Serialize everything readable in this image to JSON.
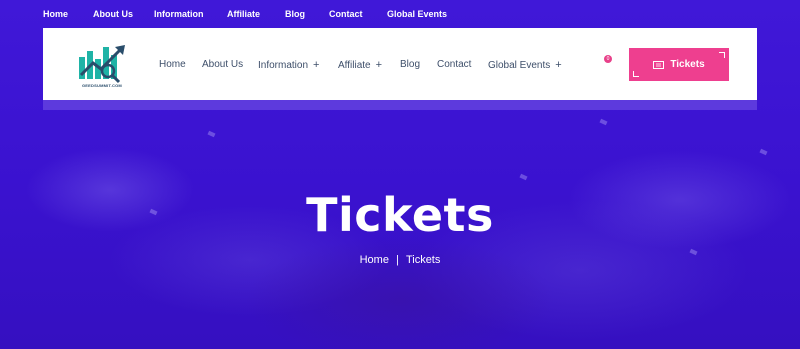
{
  "topbar": {
    "links": [
      "Home",
      "About Us",
      "Information",
      "Affiliate",
      "Blog",
      "Contact",
      "Global Events"
    ]
  },
  "header": {
    "logo_text": "GEEDSUMMIT.COM",
    "nav": [
      {
        "label": "Home",
        "has_plus": false
      },
      {
        "label": "About Us",
        "has_plus": false
      },
      {
        "label": "Information",
        "has_plus": true
      },
      {
        "label": "Affiliate",
        "has_plus": true
      },
      {
        "label": "Blog",
        "has_plus": false
      },
      {
        "label": "Contact",
        "has_plus": false
      },
      {
        "label": "Global Events",
        "has_plus": true
      }
    ],
    "plus_symbol": "+",
    "cart_count": "0",
    "tickets_button": "Tickets",
    "tickets_icon": "ticket-icon"
  },
  "hero": {
    "title": "Tickets",
    "breadcrumb_home": "Home",
    "breadcrumb_sep": "|",
    "breadcrumb_current": "Tickets"
  },
  "colors": {
    "hero_bg": "#3d14d6",
    "accent_pink": "#ee3f8f",
    "nav_text": "#3e4f6a",
    "logo_teal": "#1fb3a6"
  }
}
